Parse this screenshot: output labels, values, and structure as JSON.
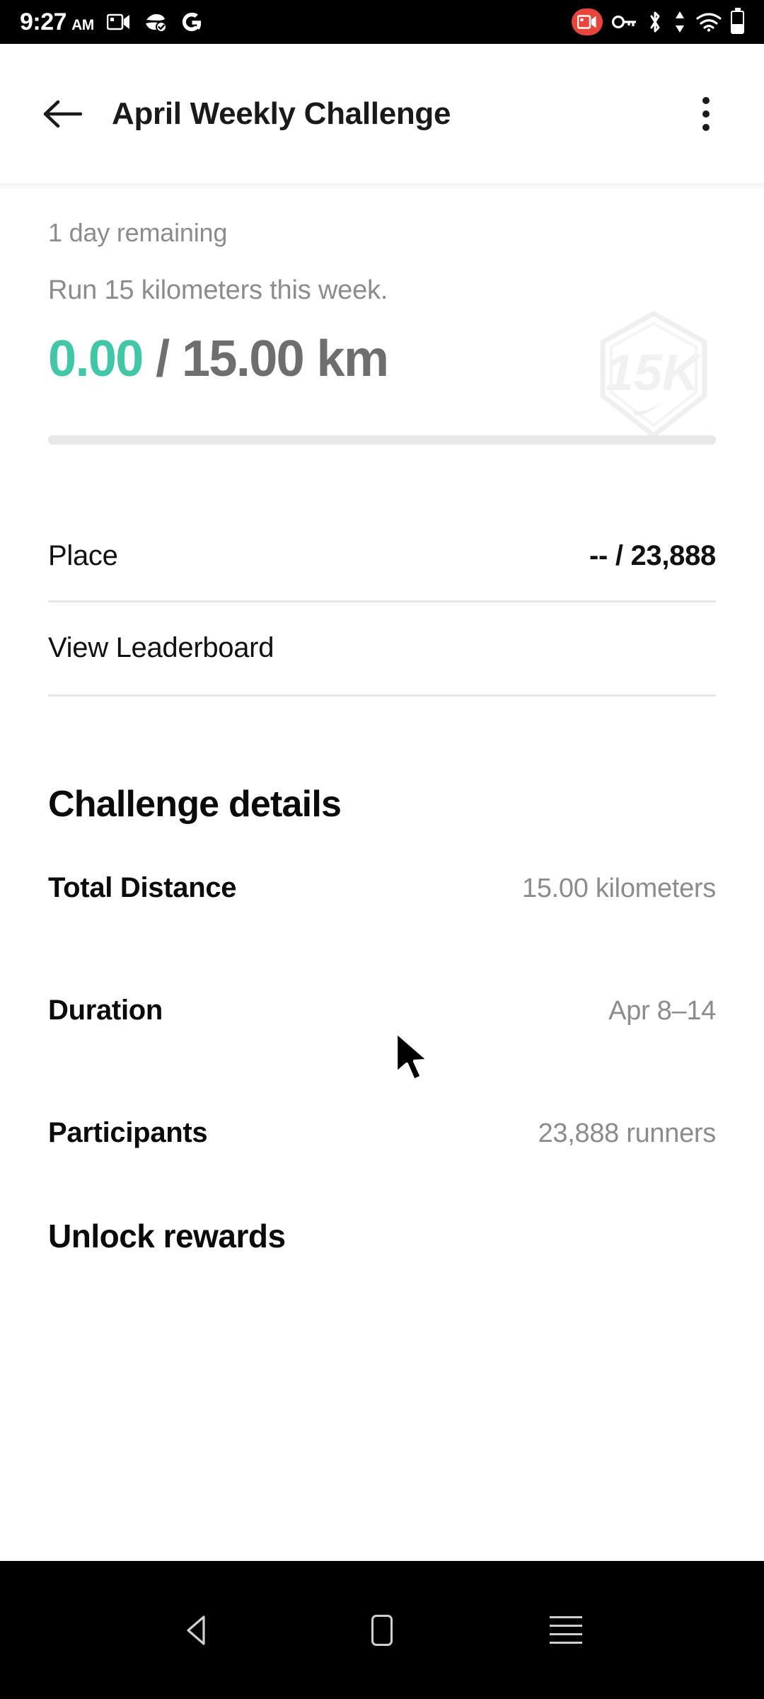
{
  "status_bar": {
    "time": "9:27",
    "am_pm": "AM",
    "left_icons": [
      "screen-record-icon",
      "shield-check-icon",
      "google-g-icon"
    ],
    "right_icons": [
      "screen-recording-active-icon",
      "vpn-key-icon",
      "bluetooth-icon",
      "data-transfer-icon",
      "wifi-icon",
      "battery-icon"
    ],
    "recording_badge_color": "#e8453c"
  },
  "app_bar": {
    "back_label": "Back",
    "title": "April Weekly Challenge",
    "overflow_label": "More options"
  },
  "challenge": {
    "remaining": "1 day remaining",
    "description": "Run 15 kilometers this week.",
    "progress_current": "0.00",
    "progress_rest": "/ 15.00 km",
    "progress_percent": 0,
    "accent_color": "#3fc7a8",
    "badge_label": "15K",
    "badge_brand": "nike-swoosh"
  },
  "place_row": {
    "label": "Place",
    "value": "-- / 23,888"
  },
  "leaderboard": {
    "label": "View Leaderboard"
  },
  "details": {
    "title": "Challenge details",
    "rows": [
      {
        "label": "Total Distance",
        "value": "15.00 kilometers"
      },
      {
        "label": "Duration",
        "value": "Apr 8–14"
      },
      {
        "label": "Participants",
        "value": "23,888 runners"
      }
    ]
  },
  "rewards": {
    "title": "Unlock rewards"
  },
  "nav_bar": {
    "back": "back-triangle-icon",
    "home": "home-square-icon",
    "recents": "recents-lines-icon"
  }
}
